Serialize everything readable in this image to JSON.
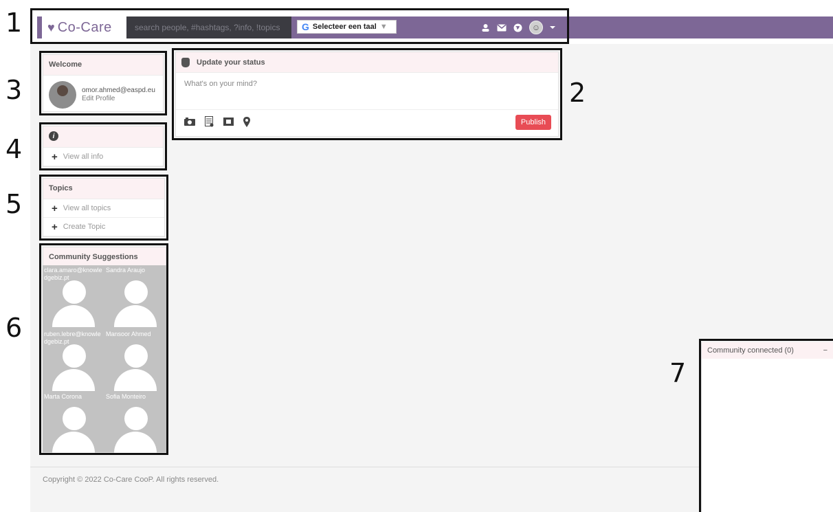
{
  "annotations": [
    "1",
    "2",
    "3",
    "4",
    "5",
    "6",
    "7"
  ],
  "navbar": {
    "brand": "Co-Care",
    "brand_heart": "♥",
    "search_placeholder": "search people, #hashtags, ?info, !topics",
    "translate_label": "Selecteer een taal",
    "translate_google": "G",
    "translate_arrow": "▼",
    "icons": [
      "user-icon",
      "mail-icon",
      "globe-icon",
      "avatar-menu-icon"
    ],
    "color": "#7d6796"
  },
  "status": {
    "title": "Update your status",
    "placeholder": "What's on your mind?",
    "publish_label": "Publish",
    "tool_icons": [
      "camera-icon",
      "document-icon",
      "video-icon",
      "location-icon"
    ],
    "publish_color": "#e84c55"
  },
  "welcome": {
    "title": "Welcome",
    "email": "omor.ahmed@easpd.eu",
    "edit_profile": "Edit Profile"
  },
  "info": {
    "view_all": "View all info"
  },
  "topics": {
    "title": "Topics",
    "view_all": "View all topics",
    "create": "Create Topic"
  },
  "suggestions": {
    "title": "Community Suggestions",
    "people": [
      {
        "name": "clara.amaro@knowledgebiz.pt"
      },
      {
        "name": "Sandra Araujo"
      },
      {
        "name": "ruben.lebre@knowledgebiz.pt"
      },
      {
        "name": "Mansoor Ahmed"
      },
      {
        "name": "Marta Corona"
      },
      {
        "name": "Sofia Monteiro"
      }
    ]
  },
  "community_connected": {
    "title": "Community connected (0)",
    "minimize": "−"
  },
  "footer": {
    "copyright": "Copyright © 2022 Co-Care CooP. All rights reserved."
  }
}
